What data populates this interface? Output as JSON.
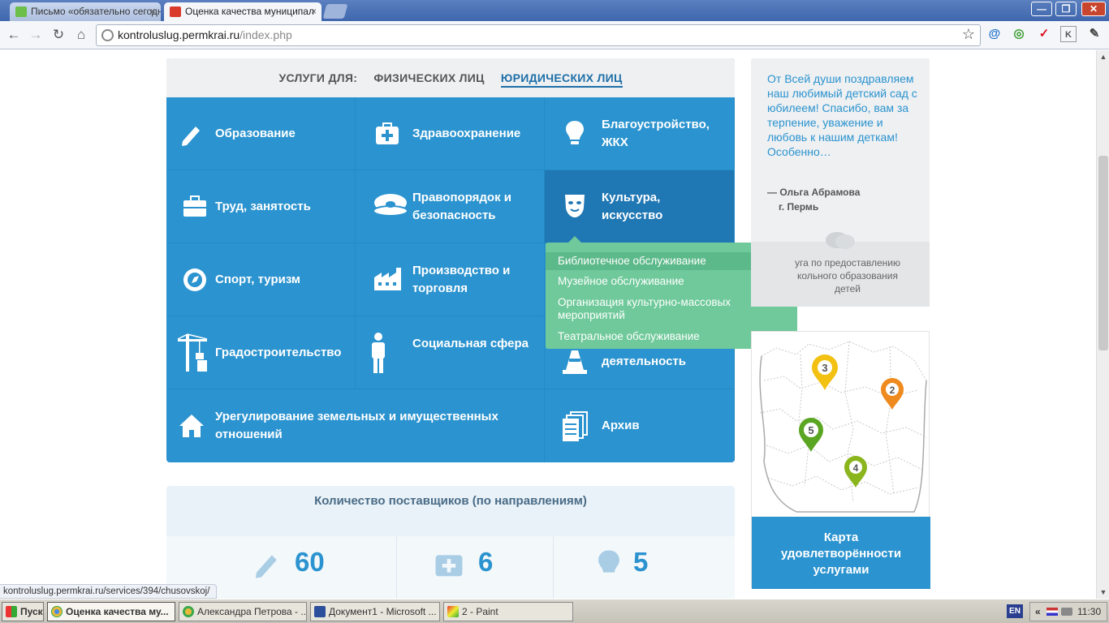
{
  "browser": {
    "tabs": [
      {
        "title": "Письмо «обязательно сегодн",
        "active": false,
        "close": "×"
      },
      {
        "title": "Оценка качества муниципал",
        "active": true,
        "close": "×"
      }
    ],
    "window_controls": [
      "—",
      "❐",
      "✕"
    ],
    "url_host": "kontroluslug.permkrai.ru",
    "url_path": "/index.php",
    "status_url": "kontroluslug.permkrai.ru/services/394/chusovskoj/"
  },
  "services": {
    "header_prefix": "УСЛУГИ ДЛЯ:",
    "tab_individuals": "ФИЗИЧЕСКИХ ЛИЦ",
    "tab_legal": "ЮРИДИЧЕСКИХ ЛИЦ",
    "items": [
      {
        "label": "Образование",
        "icon": "pencil-icon"
      },
      {
        "label": "Здравоохранение",
        "icon": "medkit-icon"
      },
      {
        "label": "Благоустройство, ЖКХ",
        "icon": "lightbulb-icon"
      },
      {
        "label": "Труд, занятость",
        "icon": "briefcase-icon"
      },
      {
        "label": "Правопорядок и безопасность",
        "icon": "police-cap-icon"
      },
      {
        "label": "Культура, искусство",
        "icon": "mask-icon"
      },
      {
        "label": "Спорт, туризм",
        "icon": "compass-icon"
      },
      {
        "label": "Производство и торговля",
        "icon": "factory-icon"
      },
      {
        "label": "Градостроительство",
        "icon": "crane-icon"
      },
      {
        "label": "Социальная сфера",
        "icon": "person-icon"
      },
      {
        "label": "деятельность",
        "icon": "traffic-cone-icon"
      },
      {
        "label": "Урегулирование земельных и имущественных отношений",
        "icon": "house-icon"
      },
      {
        "label": "Архив",
        "icon": "documents-icon"
      }
    ],
    "dropdown": [
      "Библиотечное обслуживание",
      "Музейное обслуживание",
      "Организация культурно-массовых мероприятий",
      "Театральное обслуживание"
    ]
  },
  "stats": {
    "title": "Количество поставщиков (по направлениям)",
    "items": [
      {
        "icon": "pencil-icon",
        "value": "60"
      },
      {
        "icon": "medkit-icon",
        "value": "6"
      },
      {
        "icon": "lightbulb-icon",
        "value": "5"
      }
    ]
  },
  "review": {
    "quote": "От Всей души поздравляем наш любимый детский сад с юбилеем! Спасибо, вам за терпение, уважение и любовь к нашим деткам! Особенно…",
    "author": "— Ольга Абрамова",
    "city": "г. Пермь",
    "category": "уга по предоставлению кольного образования детей"
  },
  "map": {
    "pins": [
      {
        "label": "3",
        "color": "#f2c111"
      },
      {
        "label": "2",
        "color": "#ef8a1f"
      },
      {
        "label": "5",
        "color": "#5aa521"
      },
      {
        "label": "4",
        "color": "#8ab51d"
      }
    ],
    "caption": "Карта удовлетворённости услугами"
  },
  "taskbar": {
    "start": "Пуск",
    "tasks": [
      {
        "label": "Оценка качества му...",
        "active": true
      },
      {
        "label": "Александра Петрова - ...",
        "active": false
      },
      {
        "label": "Документ1 - Microsoft ...",
        "active": false
      },
      {
        "label": "2 - Paint",
        "active": false
      }
    ],
    "lang": "EN",
    "clock": "11:30"
  }
}
